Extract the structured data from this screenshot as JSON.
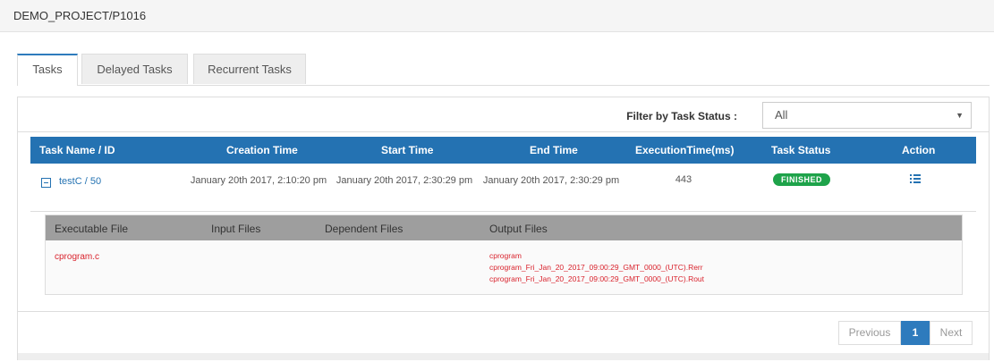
{
  "header": {
    "title": "DEMO_PROJECT/P1016"
  },
  "tabs": [
    {
      "label": "Tasks",
      "active": true
    },
    {
      "label": "Delayed Tasks",
      "active": false
    },
    {
      "label": "Recurrent Tasks",
      "active": false
    }
  ],
  "filter": {
    "label": "Filter by Task Status :",
    "selected": "All"
  },
  "table": {
    "headers": [
      "Task Name / ID",
      "Creation Time",
      "Start Time",
      "End Time",
      "ExecutionTime(ms)",
      "Task Status",
      "Action"
    ],
    "row": {
      "name_id": "testC / 50",
      "creation_time": "January 20th 2017, 2:10:20 pm",
      "start_time": "January 20th 2017, 2:30:29 pm",
      "end_time": "January 20th 2017, 2:30:29 pm",
      "execution_time": "443",
      "status": "FINISHED",
      "action_icon": "list-icon"
    }
  },
  "files": {
    "headers": [
      "Executable File",
      "Input Files",
      "Dependent Files",
      "Output Files"
    ],
    "executable": "cprogram.c",
    "outputs": [
      "cprogram",
      "cprogram_Fri_Jan_20_2017_09:00:29_GMT_0000_(UTC).Rerr",
      "cprogram_Fri_Jan_20_2017_09:00:29_GMT_0000_(UTC).Rout"
    ]
  },
  "pagination": {
    "previous": "Previous",
    "current": "1",
    "next": "Next"
  },
  "colors": {
    "header_blue": "#2472b2",
    "finished_green": "#1ea34a",
    "file_red": "#d9232d"
  }
}
